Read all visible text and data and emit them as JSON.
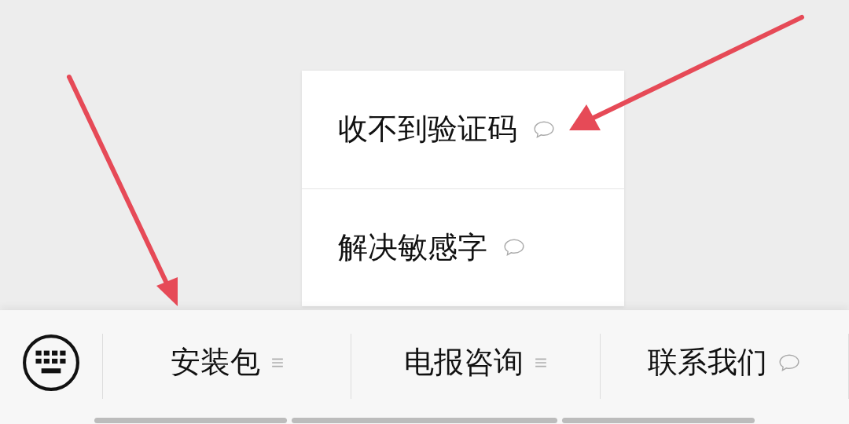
{
  "popup_menu": {
    "items": [
      {
        "label": "收不到验证码",
        "kind": "message"
      },
      {
        "label": "解决敏感字",
        "kind": "message"
      }
    ]
  },
  "menu_bar": {
    "items": [
      {
        "label": "安装包",
        "kind": "submenu"
      },
      {
        "label": "电报咨询",
        "kind": "submenu"
      },
      {
        "label": "联系我们",
        "kind": "message"
      }
    ]
  }
}
